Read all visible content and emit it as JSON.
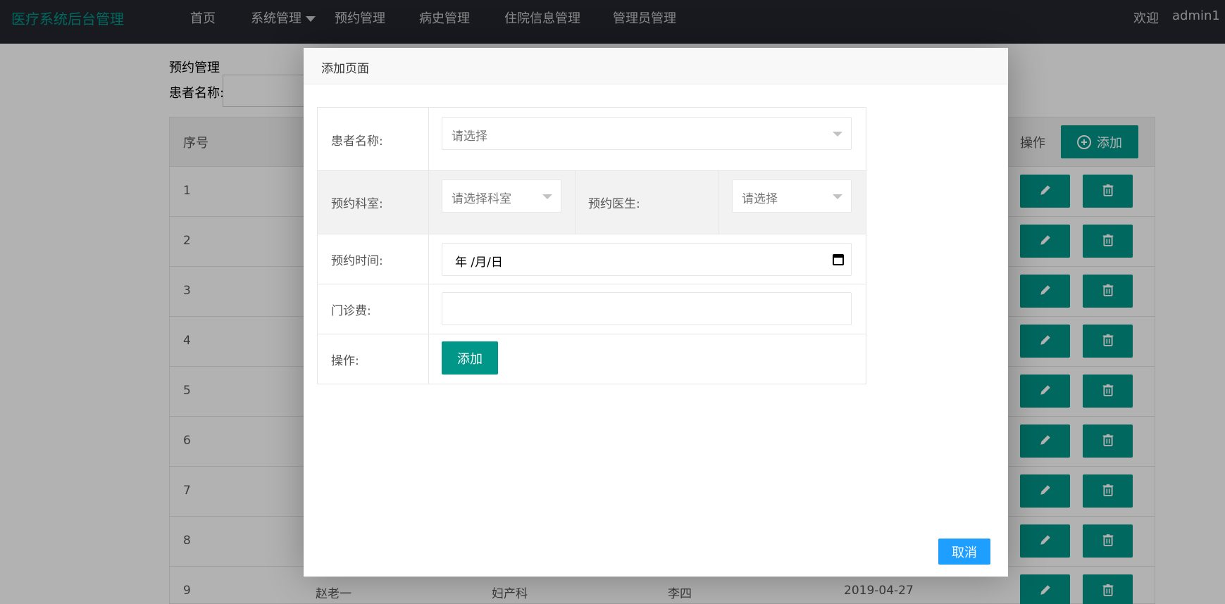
{
  "brand": "医疗系统后台管理",
  "nav": {
    "items": [
      "首页",
      "系统管理",
      "预约管理",
      "病史管理",
      "住院信息管理",
      "管理员管理"
    ],
    "welcome": "欢迎",
    "user": "admin1"
  },
  "page": {
    "title": "预约管理",
    "search_label": "患者名称:"
  },
  "table": {
    "header_seq": "序号",
    "header_op": "操作",
    "add_label": "添加",
    "rows": [
      {
        "seq": "1"
      },
      {
        "seq": "2"
      },
      {
        "seq": "3"
      },
      {
        "seq": "4"
      },
      {
        "seq": "5"
      },
      {
        "seq": "6"
      },
      {
        "seq": "7"
      },
      {
        "seq": "8"
      },
      {
        "seq": "9",
        "patient": "赵老一",
        "dept": "妇产科",
        "doctor": "李四",
        "date": "2019-04-27"
      }
    ]
  },
  "modal": {
    "title": "添加页面",
    "patient_label": "患者名称:",
    "patient_placeholder": "请选择",
    "dept_label": "预约科室:",
    "dept_placeholder": "请选择科室",
    "doctor_label": "预约医生:",
    "doctor_placeholder": "请选择",
    "time_label": "预约时间:",
    "date_placeholder": "年 /月/日",
    "fee_label": "门诊费:",
    "fee_value": "",
    "op_label": "操作:",
    "submit_label": "添加",
    "cancel_label": "取消"
  },
  "colors": {
    "primary": "#009688",
    "nav_bg": "#23262e",
    "cancel": "#1e9fff"
  }
}
